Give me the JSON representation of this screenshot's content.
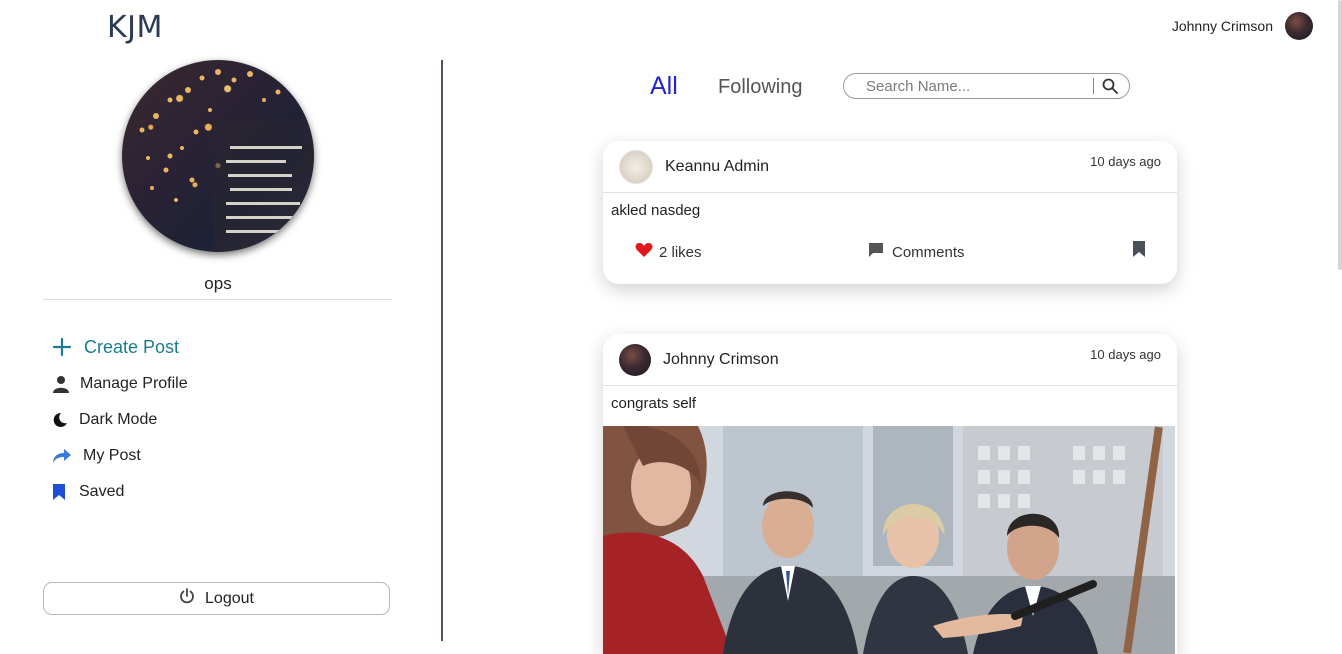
{
  "header": {
    "brand": "KJM",
    "user_name": "Johnny Crimson"
  },
  "sidebar": {
    "profile_name": "ops",
    "menu": [
      {
        "label": "Create Post",
        "icon": "plus-icon"
      },
      {
        "label": "Manage Profile",
        "icon": "user-icon"
      },
      {
        "label": "Dark Mode",
        "icon": "moon-icon"
      },
      {
        "label": "My Post",
        "icon": "share-arrow-icon"
      },
      {
        "label": "Saved",
        "icon": "bookmark-icon"
      }
    ],
    "logout_label": "Logout"
  },
  "feed": {
    "tabs": {
      "all": "All",
      "following": "Following"
    },
    "search_placeholder": "Search Name...",
    "posts": [
      {
        "author": "Keannu Admin",
        "time": "10 days ago",
        "text": "akled nasdeg",
        "likes": "2 likes",
        "comments_label": "Comments"
      },
      {
        "author": "Johnny Crimson",
        "time": "10 days ago",
        "text": "congrats self"
      }
    ]
  },
  "colors": {
    "accent_blue": "#2323d1",
    "create_post_teal": "#1b7d8c",
    "like_red": "#e3161b",
    "divider_line": "#4b5566"
  }
}
